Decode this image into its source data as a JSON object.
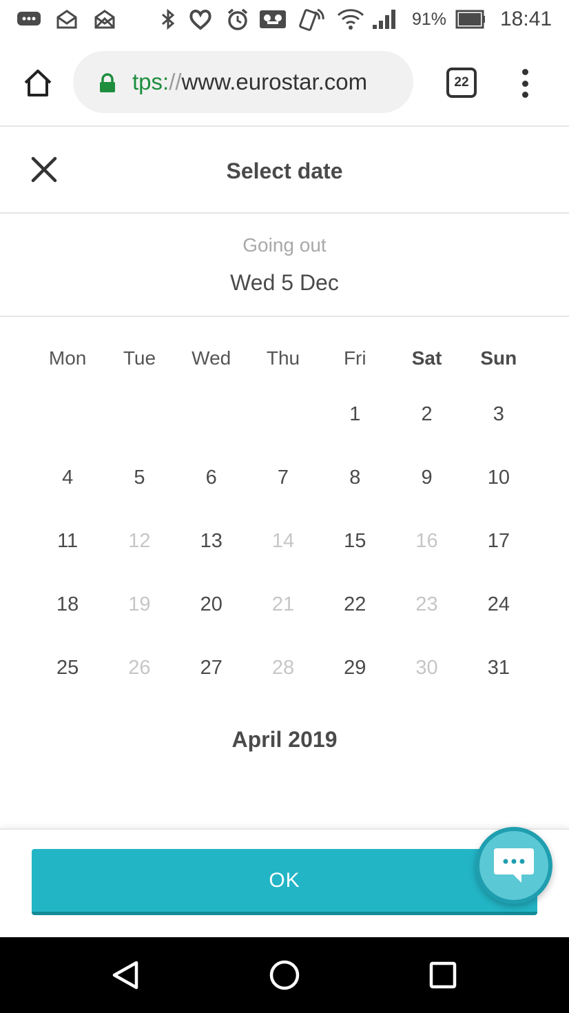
{
  "status_bar": {
    "battery": "91%",
    "time": "18:41",
    "icons": [
      "chat-notification-icon",
      "mail-notification-icon",
      "mail-notification-icon",
      "bluetooth-icon",
      "heart-icon",
      "alarm-icon",
      "voicemail-icon",
      "nfc-icon",
      "wifi-icon",
      "signal-icon",
      "battery-icon"
    ]
  },
  "browser": {
    "url_scheme": "tps:",
    "url_sep": "//",
    "url_host": "www.eurostar.com",
    "tab_count": "22",
    "accent_secure": "#1e8e3e"
  },
  "modal": {
    "title": "Select date"
  },
  "going_out": {
    "label": "Going out",
    "date": "Wed 5 Dec"
  },
  "calendar": {
    "weekdays": [
      "Mon",
      "Tue",
      "Wed",
      "Thu",
      "Fri",
      "Sat",
      "Sun"
    ],
    "weeks": [
      [
        {
          "d": ""
        },
        {
          "d": ""
        },
        {
          "d": ""
        },
        {
          "d": ""
        },
        {
          "d": "1",
          "enabled": true
        },
        {
          "d": "2",
          "enabled": true
        },
        {
          "d": "3",
          "enabled": true
        }
      ],
      [
        {
          "d": "4",
          "enabled": true
        },
        {
          "d": "5",
          "enabled": true
        },
        {
          "d": "6",
          "enabled": true
        },
        {
          "d": "7",
          "enabled": true
        },
        {
          "d": "8",
          "enabled": true
        },
        {
          "d": "9",
          "enabled": true
        },
        {
          "d": "10",
          "enabled": true
        }
      ],
      [
        {
          "d": "11",
          "enabled": true
        },
        {
          "d": "12",
          "enabled": false
        },
        {
          "d": "13",
          "enabled": true
        },
        {
          "d": "14",
          "enabled": false
        },
        {
          "d": "15",
          "enabled": true
        },
        {
          "d": "16",
          "enabled": false
        },
        {
          "d": "17",
          "enabled": true
        }
      ],
      [
        {
          "d": "18",
          "enabled": true
        },
        {
          "d": "19",
          "enabled": false
        },
        {
          "d": "20",
          "enabled": true
        },
        {
          "d": "21",
          "enabled": false
        },
        {
          "d": "22",
          "enabled": true
        },
        {
          "d": "23",
          "enabled": false
        },
        {
          "d": "24",
          "enabled": true
        }
      ],
      [
        {
          "d": "25",
          "enabled": true
        },
        {
          "d": "26",
          "enabled": false
        },
        {
          "d": "27",
          "enabled": true
        },
        {
          "d": "28",
          "enabled": false
        },
        {
          "d": "29",
          "enabled": true
        },
        {
          "d": "30",
          "enabled": false
        },
        {
          "d": "31",
          "enabled": true
        }
      ]
    ],
    "next_month_label": "April 2019"
  },
  "footer": {
    "ok_label": "OK",
    "accent": "#22b5c6"
  },
  "nav": {
    "icons": [
      "back-icon",
      "home-circle-icon",
      "recents-icon"
    ]
  }
}
